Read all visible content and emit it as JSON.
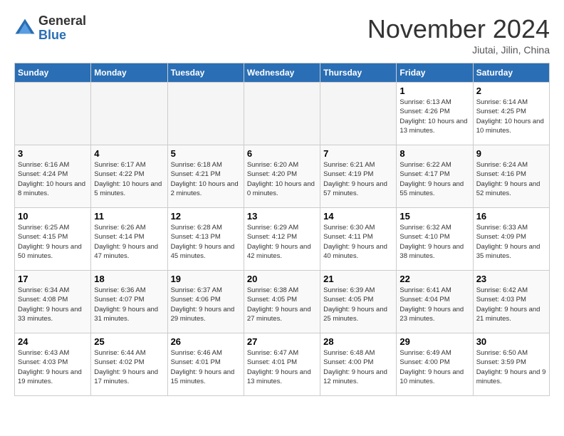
{
  "header": {
    "logo_general": "General",
    "logo_blue": "Blue",
    "month_title": "November 2024",
    "location": "Jiutai, Jilin, China"
  },
  "weekdays": [
    "Sunday",
    "Monday",
    "Tuesday",
    "Wednesday",
    "Thursday",
    "Friday",
    "Saturday"
  ],
  "weeks": [
    [
      {
        "day": "",
        "info": "",
        "empty": true
      },
      {
        "day": "",
        "info": "",
        "empty": true
      },
      {
        "day": "",
        "info": "",
        "empty": true
      },
      {
        "day": "",
        "info": "",
        "empty": true
      },
      {
        "day": "",
        "info": "",
        "empty": true
      },
      {
        "day": "1",
        "info": "Sunrise: 6:13 AM\nSunset: 4:26 PM\nDaylight: 10 hours and 13 minutes."
      },
      {
        "day": "2",
        "info": "Sunrise: 6:14 AM\nSunset: 4:25 PM\nDaylight: 10 hours and 10 minutes."
      }
    ],
    [
      {
        "day": "3",
        "info": "Sunrise: 6:16 AM\nSunset: 4:24 PM\nDaylight: 10 hours and 8 minutes."
      },
      {
        "day": "4",
        "info": "Sunrise: 6:17 AM\nSunset: 4:22 PM\nDaylight: 10 hours and 5 minutes."
      },
      {
        "day": "5",
        "info": "Sunrise: 6:18 AM\nSunset: 4:21 PM\nDaylight: 10 hours and 2 minutes."
      },
      {
        "day": "6",
        "info": "Sunrise: 6:20 AM\nSunset: 4:20 PM\nDaylight: 10 hours and 0 minutes."
      },
      {
        "day": "7",
        "info": "Sunrise: 6:21 AM\nSunset: 4:19 PM\nDaylight: 9 hours and 57 minutes."
      },
      {
        "day": "8",
        "info": "Sunrise: 6:22 AM\nSunset: 4:17 PM\nDaylight: 9 hours and 55 minutes."
      },
      {
        "day": "9",
        "info": "Sunrise: 6:24 AM\nSunset: 4:16 PM\nDaylight: 9 hours and 52 minutes."
      }
    ],
    [
      {
        "day": "10",
        "info": "Sunrise: 6:25 AM\nSunset: 4:15 PM\nDaylight: 9 hours and 50 minutes."
      },
      {
        "day": "11",
        "info": "Sunrise: 6:26 AM\nSunset: 4:14 PM\nDaylight: 9 hours and 47 minutes."
      },
      {
        "day": "12",
        "info": "Sunrise: 6:28 AM\nSunset: 4:13 PM\nDaylight: 9 hours and 45 minutes."
      },
      {
        "day": "13",
        "info": "Sunrise: 6:29 AM\nSunset: 4:12 PM\nDaylight: 9 hours and 42 minutes."
      },
      {
        "day": "14",
        "info": "Sunrise: 6:30 AM\nSunset: 4:11 PM\nDaylight: 9 hours and 40 minutes."
      },
      {
        "day": "15",
        "info": "Sunrise: 6:32 AM\nSunset: 4:10 PM\nDaylight: 9 hours and 38 minutes."
      },
      {
        "day": "16",
        "info": "Sunrise: 6:33 AM\nSunset: 4:09 PM\nDaylight: 9 hours and 35 minutes."
      }
    ],
    [
      {
        "day": "17",
        "info": "Sunrise: 6:34 AM\nSunset: 4:08 PM\nDaylight: 9 hours and 33 minutes."
      },
      {
        "day": "18",
        "info": "Sunrise: 6:36 AM\nSunset: 4:07 PM\nDaylight: 9 hours and 31 minutes."
      },
      {
        "day": "19",
        "info": "Sunrise: 6:37 AM\nSunset: 4:06 PM\nDaylight: 9 hours and 29 minutes."
      },
      {
        "day": "20",
        "info": "Sunrise: 6:38 AM\nSunset: 4:05 PM\nDaylight: 9 hours and 27 minutes."
      },
      {
        "day": "21",
        "info": "Sunrise: 6:39 AM\nSunset: 4:05 PM\nDaylight: 9 hours and 25 minutes."
      },
      {
        "day": "22",
        "info": "Sunrise: 6:41 AM\nSunset: 4:04 PM\nDaylight: 9 hours and 23 minutes."
      },
      {
        "day": "23",
        "info": "Sunrise: 6:42 AM\nSunset: 4:03 PM\nDaylight: 9 hours and 21 minutes."
      }
    ],
    [
      {
        "day": "24",
        "info": "Sunrise: 6:43 AM\nSunset: 4:03 PM\nDaylight: 9 hours and 19 minutes."
      },
      {
        "day": "25",
        "info": "Sunrise: 6:44 AM\nSunset: 4:02 PM\nDaylight: 9 hours and 17 minutes."
      },
      {
        "day": "26",
        "info": "Sunrise: 6:46 AM\nSunset: 4:01 PM\nDaylight: 9 hours and 15 minutes."
      },
      {
        "day": "27",
        "info": "Sunrise: 6:47 AM\nSunset: 4:01 PM\nDaylight: 9 hours and 13 minutes."
      },
      {
        "day": "28",
        "info": "Sunrise: 6:48 AM\nSunset: 4:00 PM\nDaylight: 9 hours and 12 minutes."
      },
      {
        "day": "29",
        "info": "Sunrise: 6:49 AM\nSunset: 4:00 PM\nDaylight: 9 hours and 10 minutes."
      },
      {
        "day": "30",
        "info": "Sunrise: 6:50 AM\nSunset: 3:59 PM\nDaylight: 9 hours and 9 minutes."
      }
    ]
  ]
}
